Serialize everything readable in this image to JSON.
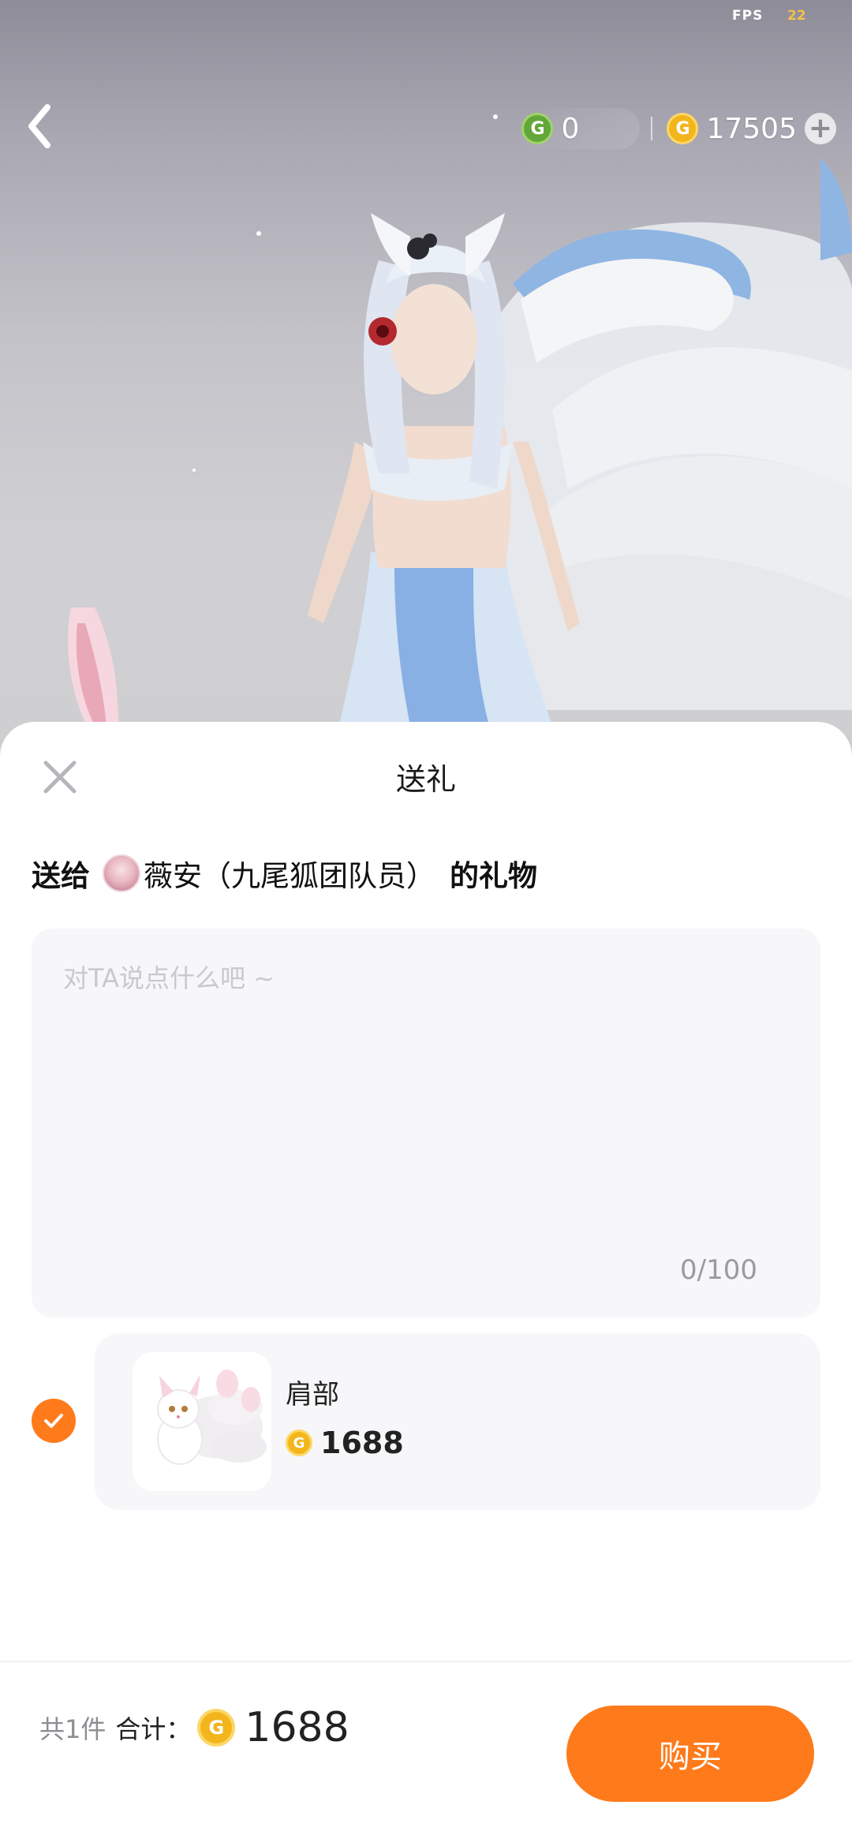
{
  "status": {
    "fps_label": "FPS",
    "fps_value": "22"
  },
  "header": {
    "green_currency_value": "0",
    "gold_currency_value": "17505"
  },
  "sheet": {
    "title": "送礼",
    "recipient_prefix": "送给",
    "recipient_name": "薇安（九尾狐团队员）",
    "recipient_suffix": "的礼物",
    "message_placeholder": "对TA说点什么吧 ~",
    "message_counter": "0/100"
  },
  "gift": {
    "name": "肩部",
    "price": "1688",
    "selected": true
  },
  "footer": {
    "count_label": "共1件",
    "total_label": "合计：",
    "total_value": "1688",
    "buy_label": "购买"
  },
  "colors": {
    "accent": "#ff7a1a",
    "coin_gold": "#f3b51c",
    "coin_green": "#63a63a"
  }
}
